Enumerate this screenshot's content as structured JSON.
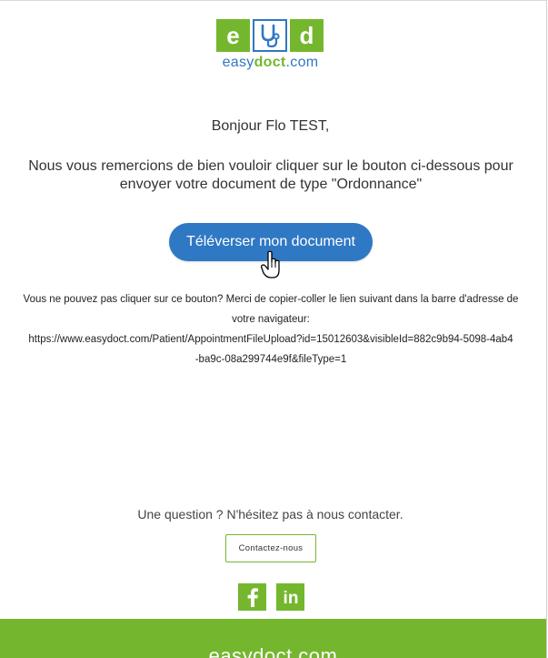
{
  "logo": {
    "tiles": [
      "e",
      "d"
    ],
    "brand_prefix": "easy",
    "brand_strong": "doct",
    "brand_suffix": ".com",
    "colors": {
      "green": "#74b72e",
      "blue": "#2f78c4"
    }
  },
  "email": {
    "greeting": "Bonjour Flo TEST,",
    "message": "Nous vous remercions de bien vouloir cliquer sur le bouton ci-dessous pour envoyer votre document de type \"Ordonnance\"",
    "upload_button": "Téléverser mon document",
    "fallback_text": "Vous ne pouvez pas cliquer sur ce bouton? Merci de copier-coller le lien suivant dans la barre d'adresse de votre navigateur:",
    "fallback_link": "https://www.easydoct.com/Patient/AppointmentFileUpload?id=15012603&visibleId=882c9b94-5098-4ab4-ba9c-08a299744e9f&fileType=1"
  },
  "contact": {
    "question": "Une question ? N'hésitez pas à nous contacter.",
    "button": "Contactez-nous"
  },
  "social": {
    "facebook_icon": "facebook-icon",
    "linkedin_icon": "linkedin-icon",
    "linkedin_glyph": "in"
  },
  "footer": {
    "text": "easydoct.com"
  }
}
